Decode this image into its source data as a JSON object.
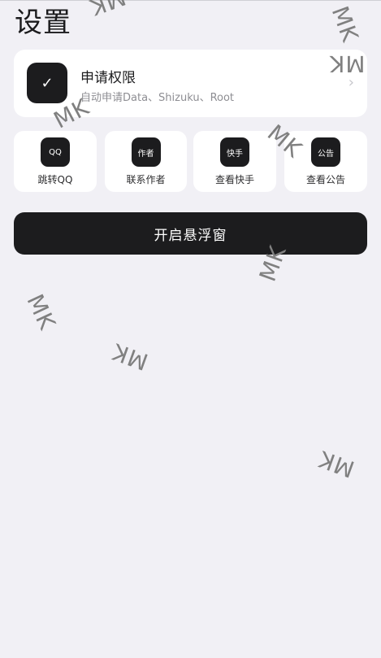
{
  "page": {
    "title": "设置"
  },
  "permission_card": {
    "icon": "checkmark-icon",
    "icon_glyph": "✓",
    "title": "申请权限",
    "subtitle": "自动申请Data、Shizuku、Root",
    "chevron_glyph": "›"
  },
  "quick_actions": [
    {
      "icon_text": "QQ",
      "label": "跳转QQ"
    },
    {
      "icon_text": "作者",
      "label": "联系作者"
    },
    {
      "icon_text": "快手",
      "label": "查看快手"
    },
    {
      "icon_text": "公告",
      "label": "查看公告"
    }
  ],
  "float_button": {
    "label": "开启悬浮窗"
  },
  "watermarks": [
    "MK",
    "MK",
    "MK",
    "MK",
    "MK",
    "MK",
    "MK",
    "MK",
    "MK"
  ],
  "colors": {
    "background": "#f1f0f5",
    "card": "#ffffff",
    "accent": "#1c1c1e",
    "watermark": "#808080"
  }
}
